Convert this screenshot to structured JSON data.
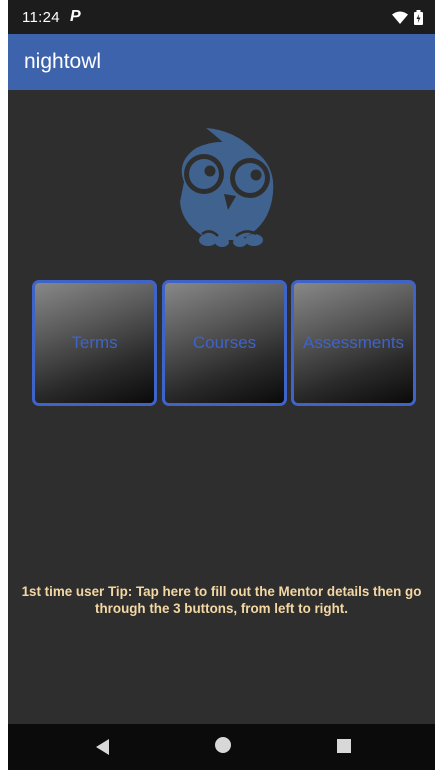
{
  "status_bar": {
    "time": "11:24",
    "notification_icon": "p-icon",
    "wifi_icon": "wifi-icon",
    "battery_icon": "battery-icon"
  },
  "app_bar": {
    "title": "nightowl"
  },
  "logo": {
    "icon": "owl-icon",
    "color": "#40628f"
  },
  "buttons": [
    {
      "label": "Terms"
    },
    {
      "label": "Courses"
    },
    {
      "label": "Assessments"
    }
  ],
  "tip": {
    "text": "1st time user Tip: Tap here to fill out the Mentor details then go\nthrough the 3 buttons, from left to right."
  },
  "colors": {
    "app_bar": "#3e63ad",
    "background": "#2e2e2e",
    "button_border": "#3e63c9",
    "button_text": "#3e63c9",
    "tip_text": "#f4d8a4"
  },
  "nav_bar": {
    "back_icon": "back-triangle-icon",
    "home_icon": "home-circle-icon",
    "recent_icon": "recent-square-icon"
  }
}
